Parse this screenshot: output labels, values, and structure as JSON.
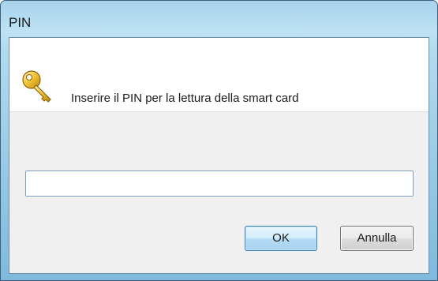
{
  "window": {
    "title": "PIN"
  },
  "dialog": {
    "icon": "key-icon",
    "message": "Inserire il PIN per la lettura della smart card",
    "pin_value": "",
    "pin_placeholder": ""
  },
  "buttons": {
    "ok_label": "OK",
    "cancel_label": "Annulla"
  },
  "colors": {
    "key_gold": "#e9b82a",
    "ok_border": "#3c7fb1"
  }
}
